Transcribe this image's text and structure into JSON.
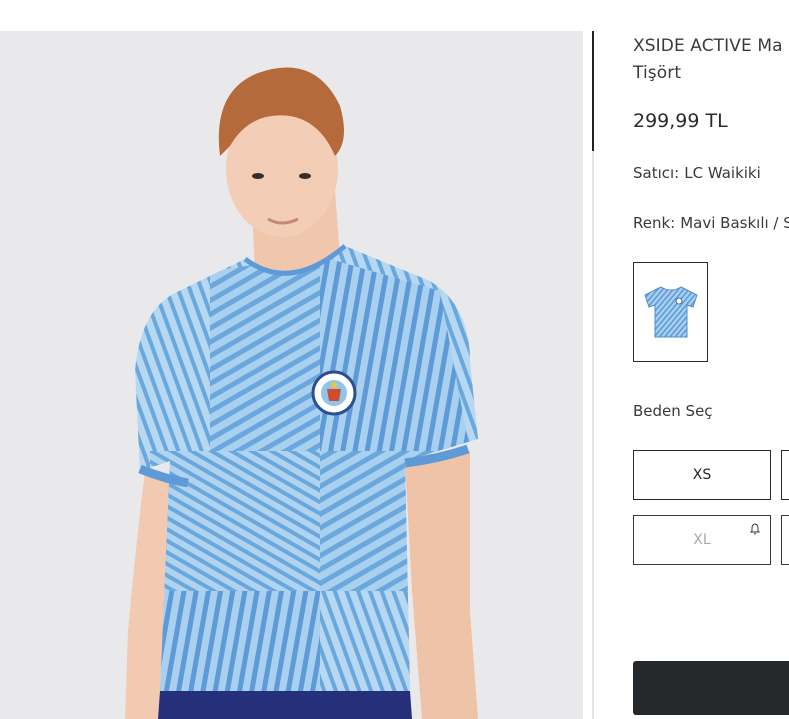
{
  "product": {
    "title": "XSIDE ACTIVE Ma… Tişört",
    "title_line1": "XSIDE ACTIVE Ma",
    "title_line2": "Tişört",
    "price": "299,99 TL",
    "seller_label": "Satıcı:",
    "seller_value": "LC Waikiki",
    "color_label": "Renk:",
    "color_value": "Mavi Baskılı / S"
  },
  "sizes": {
    "label": "Beden Seç",
    "options": [
      {
        "label": "XS",
        "available": true
      },
      {
        "label": "XL",
        "available": false
      }
    ]
  },
  "colors": {
    "shirt_light": "#a9d0ee",
    "shirt_stripe": "#6aa7dc",
    "cuff": "#5f9ad8",
    "button_dark": "#25282b",
    "background": "#e9e9eb"
  },
  "icons": {
    "notify": "bell-icon"
  }
}
